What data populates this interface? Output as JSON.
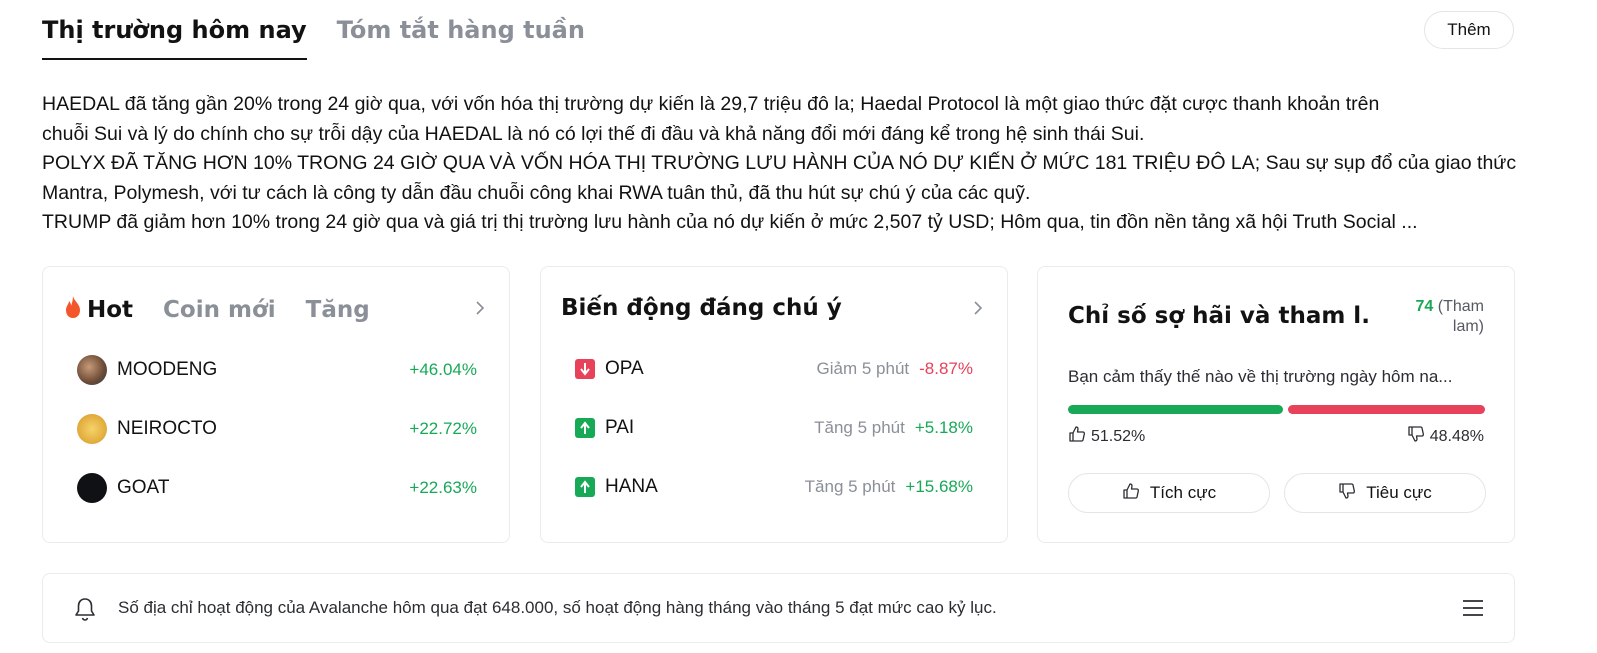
{
  "tabs": [
    {
      "label": "Thị trường hôm nay",
      "active": true
    },
    {
      "label": "Tóm tắt hàng tuần",
      "active": false
    }
  ],
  "more_label": "Thêm",
  "summary": [
    "HAEDAL đã tăng gần 20% trong 24 giờ qua, với vốn hóa thị trường dự kiến là 29,7 triệu đô la; Haedal Protocol là một giao thức đặt cược thanh khoản trên",
    "chuỗi Sui và lý do chính cho sự trỗi dậy của HAEDAL là nó có lợi thế đi đầu và khả năng đổi mới đáng kể trong hệ sinh thái Sui.",
    "POLYX ĐÃ TĂNG HƠN 10% TRONG 24 GIỜ QUA VÀ VỐN HÓA THỊ TRƯỜNG LƯU HÀNH CỦA NÓ DỰ KIẾN Ở MỨC 181 TRIỆU ĐÔ LA; Sau sự sụp đổ của giao thức",
    "Mantra, Polymesh, với tư cách là công ty dẫn đầu chuỗi công khai RWA tuân thủ, đã thu hút sự chú ý của các quỹ.",
    "TRUMP đã giảm hơn 10% trong 24 giờ qua và giá trị thị trường lưu hành của nó dự kiến ở mức 2,507 tỷ USD; Hôm qua, tin đồn nền tảng xã hội Truth Social ..."
  ],
  "hot_card": {
    "tabs": [
      {
        "label": "Hot",
        "icon": "flame-icon",
        "active": true
      },
      {
        "label": "Coin mới",
        "active": false
      },
      {
        "label": "Tăng",
        "active": false
      }
    ],
    "coins": [
      {
        "name": "MOODENG",
        "change": "+46.04%",
        "color": "#8a6a52"
      },
      {
        "name": "NEIROCTO",
        "change": "+22.72%",
        "color": "#e8b84a"
      },
      {
        "name": "GOAT",
        "change": "+22.63%",
        "color": "#0f1114"
      }
    ]
  },
  "movers_card": {
    "title": "Biến động đáng chú ý",
    "items": [
      {
        "name": "OPA",
        "direction": "down",
        "label": "Giảm 5 phút",
        "value": "-8.87%"
      },
      {
        "name": "PAI",
        "direction": "up",
        "label": "Tăng 5 phút",
        "value": "+5.18%"
      },
      {
        "name": "HANA",
        "direction": "up",
        "label": "Tăng 5 phút",
        "value": "+15.68%"
      }
    ]
  },
  "fear_greed": {
    "title": "Chỉ số sợ hãi và tham l...",
    "score": "74",
    "score_label_1": "(Tham",
    "score_label_2": "lam)",
    "question": "Bạn cảm thấy thế nào về thị trường ngày hôm na...",
    "bullish_pct": "51.52%",
    "bearish_pct": "48.48%",
    "bullish_fraction": 0.5152,
    "bullish_btn": "Tích cực",
    "bearish_btn": "Tiêu cực"
  },
  "news": {
    "text": "Số địa chỉ hoạt động của Avalanche hôm qua đạt 648.000, số hoạt động hàng tháng vào tháng 5 đạt mức cao kỷ lục."
  },
  "colors": {
    "positive": "#18a957",
    "negative": "#e8415a",
    "muted": "#8a8f98"
  }
}
